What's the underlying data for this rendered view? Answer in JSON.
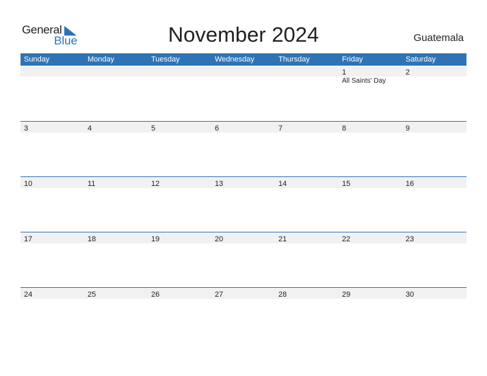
{
  "logo": {
    "line1": "General",
    "line2": "Blue"
  },
  "title": "November 2024",
  "country": "Guatemala",
  "colors": {
    "accent": "#2e74b5",
    "row_bg": "#f1f1f1"
  },
  "weekdays": [
    "Sunday",
    "Monday",
    "Tuesday",
    "Wednesday",
    "Thursday",
    "Friday",
    "Saturday"
  ],
  "weeks": [
    {
      "days": [
        "",
        "",
        "",
        "",
        "",
        "1",
        "2"
      ],
      "holidays": [
        "",
        "",
        "",
        "",
        "",
        "All Saints' Day",
        ""
      ]
    },
    {
      "days": [
        "3",
        "4",
        "5",
        "6",
        "7",
        "8",
        "9"
      ],
      "holidays": [
        "",
        "",
        "",
        "",
        "",
        "",
        ""
      ]
    },
    {
      "days": [
        "10",
        "11",
        "12",
        "13",
        "14",
        "15",
        "16"
      ],
      "holidays": [
        "",
        "",
        "",
        "",
        "",
        "",
        ""
      ]
    },
    {
      "days": [
        "17",
        "18",
        "19",
        "20",
        "21",
        "22",
        "23"
      ],
      "holidays": [
        "",
        "",
        "",
        "",
        "",
        "",
        ""
      ]
    },
    {
      "days": [
        "24",
        "25",
        "26",
        "27",
        "28",
        "29",
        "30"
      ],
      "holidays": [
        "",
        "",
        "",
        "",
        "",
        "",
        ""
      ]
    }
  ]
}
